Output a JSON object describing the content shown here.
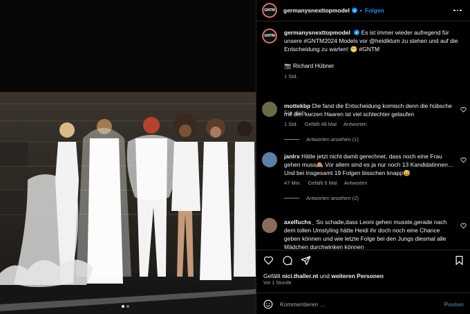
{
  "post": {
    "username": "germanysnexttopmodel",
    "avatar_text": "GNTM",
    "follow_label": "Folgen",
    "separator": "•"
  },
  "caption": {
    "username": "germanysnexttopmodel",
    "text": "Es ist immer wieder aufregend für unsere #GNTM2024 Models vor @heidiklum zu stehen und auf die Entscheidung zu warten! 😬 #GNTM",
    "credit": "📷 Richard Hübner",
    "age": "1 Std."
  },
  "for_me_label": "Für dich",
  "comments": [
    {
      "username": "mottekbp",
      "text": "Die fand die Entscheidung komisch denn die hübsche mit den kurzen Haaren ist viel schlechter gelaufen",
      "age": "1 Std.",
      "likes": "Gefällt 48 Mal",
      "reply_label": "Antworten",
      "replies_label": "Antworten ansehen (1)",
      "avatar_color": "#6b6b45"
    },
    {
      "username": "janlrx",
      "text": "Hätte jetzt nicht damit gerechnet, dass noch eine Frau gehen muss🙈 Vor allem sind es ja nur noch 13 Kandidatinnen…Und bei insgesamt 19 Folgen bisschen knapp😅",
      "age": "47 Min.",
      "likes": "Gefällt 6 Mal",
      "reply_label": "Antworten",
      "replies_label": "Antworten ansehen (2)",
      "avatar_color": "#5c7fa8"
    },
    {
      "username": "axelfuchs_",
      "text": "So schade,dass Leoni gehen musste,gerade nach dem tollen Umstyling hätte Heidi ihr doch noch eine Chance geben können und wie letzte Folge bei den Jungs diesmal alle Mädchen durchwinken können",
      "avatar_color": "#8a6a5a"
    }
  ],
  "actions": {
    "icons": [
      "heart-icon",
      "comment-icon",
      "share-icon",
      "bookmark-icon"
    ],
    "liked_prefix": "Gefällt",
    "liked_user": "nici.thaller.nt",
    "liked_and": "und",
    "liked_others": "weiteren Personen",
    "when": "Vor 1 Stunde"
  },
  "composer": {
    "placeholder": "Kommentieren …",
    "post_label": "Posten"
  },
  "colors": {
    "link_blue": "#0095f6",
    "muted": "#a8a8a8",
    "background": "#000000"
  }
}
